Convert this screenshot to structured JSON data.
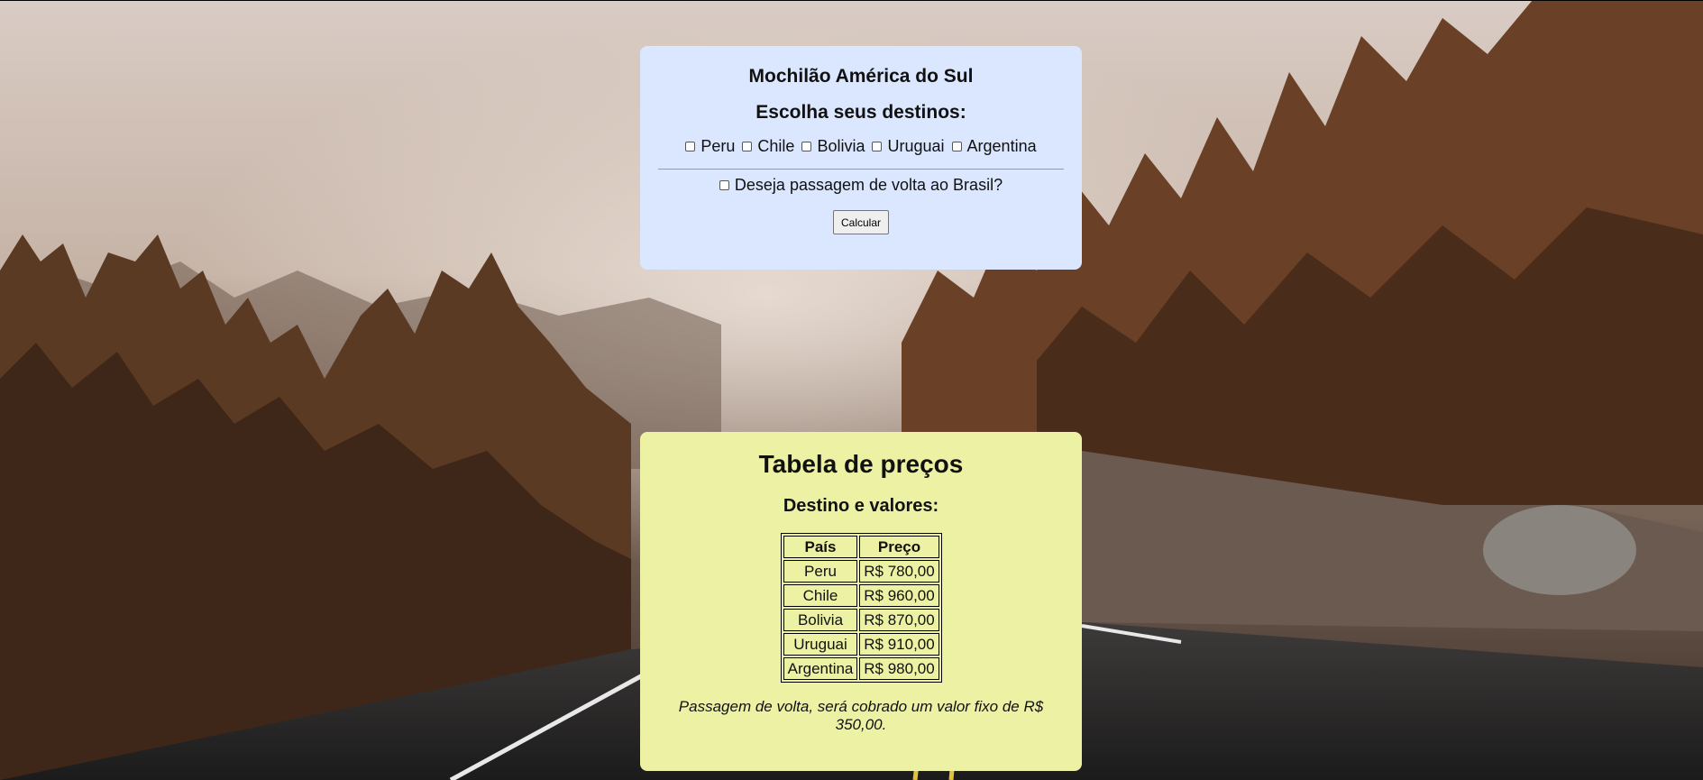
{
  "form": {
    "title": "Mochilão América do Sul",
    "subtitle": "Escolha seus destinos:",
    "destinations": [
      "Peru",
      "Chile",
      "Bolivia",
      "Uruguai",
      "Argentina"
    ],
    "return_question": "Deseja passagem de volta ao Brasil?",
    "calculate_label": "Calcular"
  },
  "prices": {
    "title": "Tabela de preços",
    "subtitle": "Destino e valores:",
    "headers": [
      "País",
      "Preço"
    ],
    "rows": [
      [
        "Peru",
        "R$ 780,00"
      ],
      [
        "Chile",
        "R$ 960,00"
      ],
      [
        "Bolivia",
        "R$ 870,00"
      ],
      [
        "Uruguai",
        "R$ 910,00"
      ],
      [
        "Argentina",
        "R$ 980,00"
      ]
    ],
    "note": "Passagem de volta, será cobrado um valor fixo de R$ 350,00."
  },
  "colors": {
    "form_bg": "#dbe6ff",
    "price_bg": "#edf1a3"
  }
}
